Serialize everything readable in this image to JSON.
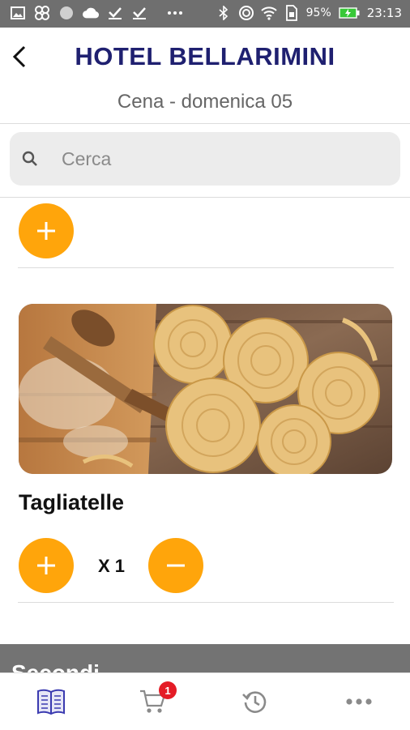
{
  "status_bar": {
    "battery": "95%",
    "time": "23:13"
  },
  "header": {
    "title": "HOTEL BELLARIMINI",
    "subtitle": "Cena - domenica 05"
  },
  "search": {
    "placeholder": "Cerca"
  },
  "dish": {
    "name": "Tagliatelle",
    "quantity": "X 1"
  },
  "section": {
    "label": "Secondi"
  },
  "tabbar": {
    "cart_badge": "1"
  },
  "colors": {
    "accent": "#ffa50b",
    "title": "#1f2070",
    "badge": "#e41c26"
  }
}
